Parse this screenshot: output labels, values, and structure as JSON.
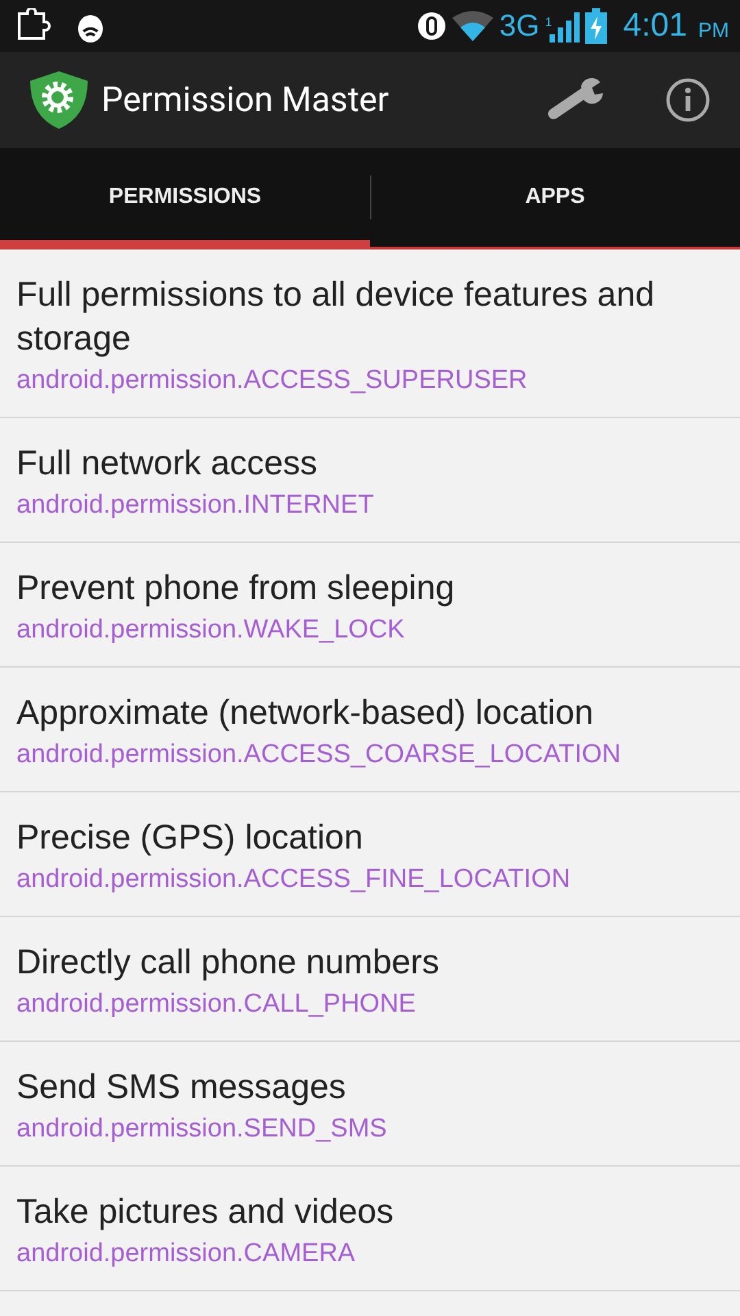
{
  "status_bar": {
    "network": "3G",
    "signal_badge": "1",
    "time": "4:01",
    "ampm": "PM"
  },
  "action_bar": {
    "title": "Permission Master"
  },
  "tabs": [
    {
      "label": "PERMISSIONS",
      "selected": true
    },
    {
      "label": "APPS",
      "selected": false
    }
  ],
  "permissions": [
    {
      "title": "Full permissions to all device features and storage",
      "name": "android.permission.ACCESS_SUPERUSER"
    },
    {
      "title": "Full network access",
      "name": "android.permission.INTERNET"
    },
    {
      "title": "Prevent phone from sleeping",
      "name": "android.permission.WAKE_LOCK"
    },
    {
      "title": "Approximate (network-based) location",
      "name": "android.permission.ACCESS_COARSE_LOCATION"
    },
    {
      "title": "Precise (GPS) location",
      "name": "android.permission.ACCESS_FINE_LOCATION"
    },
    {
      "title": "Directly call phone numbers",
      "name": "android.permission.CALL_PHONE"
    },
    {
      "title": "Send SMS messages",
      "name": "android.permission.SEND_SMS"
    },
    {
      "title": "Take pictures and videos",
      "name": "android.permission.CAMERA"
    }
  ]
}
